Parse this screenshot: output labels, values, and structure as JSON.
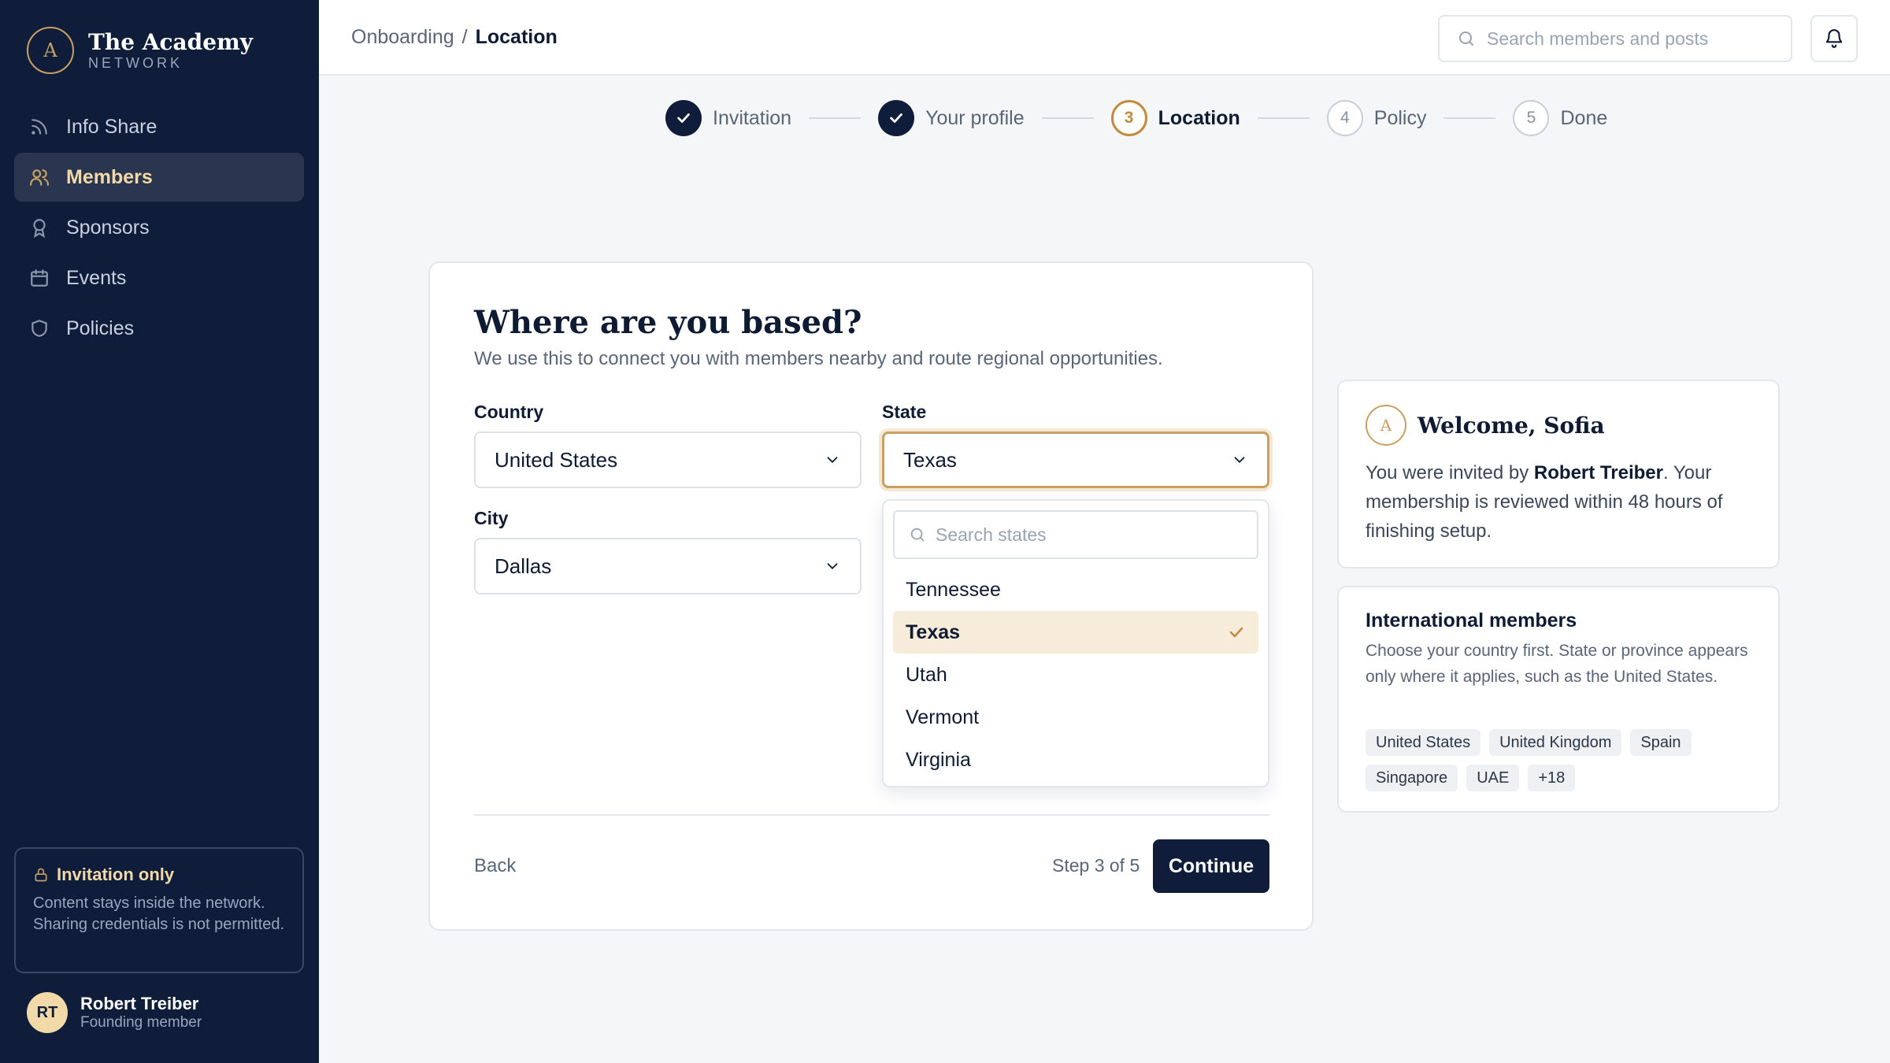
{
  "brand": {
    "mark": "A",
    "name": "The Academy",
    "sub": "NETWORK"
  },
  "nav": [
    {
      "label": "Info Share",
      "icon": "rss-icon"
    },
    {
      "label": "Members",
      "icon": "users-icon",
      "active": true
    },
    {
      "label": "Sponsors",
      "icon": "award-icon"
    },
    {
      "label": "Events",
      "icon": "calendar-icon"
    },
    {
      "label": "Policies",
      "icon": "shield-icon"
    }
  ],
  "notice": {
    "title": "Invitation only",
    "text": "Content stays inside the network. Sharing credentials is not permitted."
  },
  "user": {
    "initials": "RT",
    "name": "Robert Treiber",
    "role": "Founding member"
  },
  "breadcrumb": {
    "parent": "Onboarding",
    "separator": "/",
    "current": "Location"
  },
  "search": {
    "placeholder": "Search members and posts"
  },
  "stepper": [
    {
      "label": "Invitation",
      "state": "done",
      "number": "1"
    },
    {
      "label": "Your profile",
      "state": "done",
      "number": "2"
    },
    {
      "label": "Location",
      "state": "current",
      "number": "3"
    },
    {
      "label": "Policy",
      "state": "todo",
      "number": "4"
    },
    {
      "label": "Done",
      "state": "todo",
      "number": "5"
    }
  ],
  "form": {
    "title": "Where are you based?",
    "subtitle": "We use this to connect you with members nearby and route regional opportunities.",
    "country_label": "Country",
    "country_value": "United States",
    "state_label": "State",
    "state_value": "Texas",
    "city_label": "City",
    "city_value": "Dallas",
    "state_search_placeholder": "Search states",
    "state_options": [
      "Tennessee",
      "Texas",
      "Utah",
      "Vermont",
      "Virginia"
    ],
    "back_label": "Back",
    "step_count": "Step 3 of 5",
    "continue_label": "Continue"
  },
  "welcome": {
    "mark": "A",
    "title": "Welcome, Sofia",
    "text_prefix": "You were invited by ",
    "inviter": "Robert Treiber",
    "text_suffix": ". Your membership is reviewed within 48 hours of finishing setup."
  },
  "international": {
    "title": "International members",
    "text": "Choose your country first. State or province appears only where it applies, such as the United States.",
    "chips": [
      "United States",
      "United Kingdom",
      "Spain",
      "Singapore",
      "UAE",
      "+18"
    ]
  },
  "colors": {
    "navy": "#0f1d3a",
    "gold": "#c9a063",
    "accent_text": "#f1d9a8"
  }
}
